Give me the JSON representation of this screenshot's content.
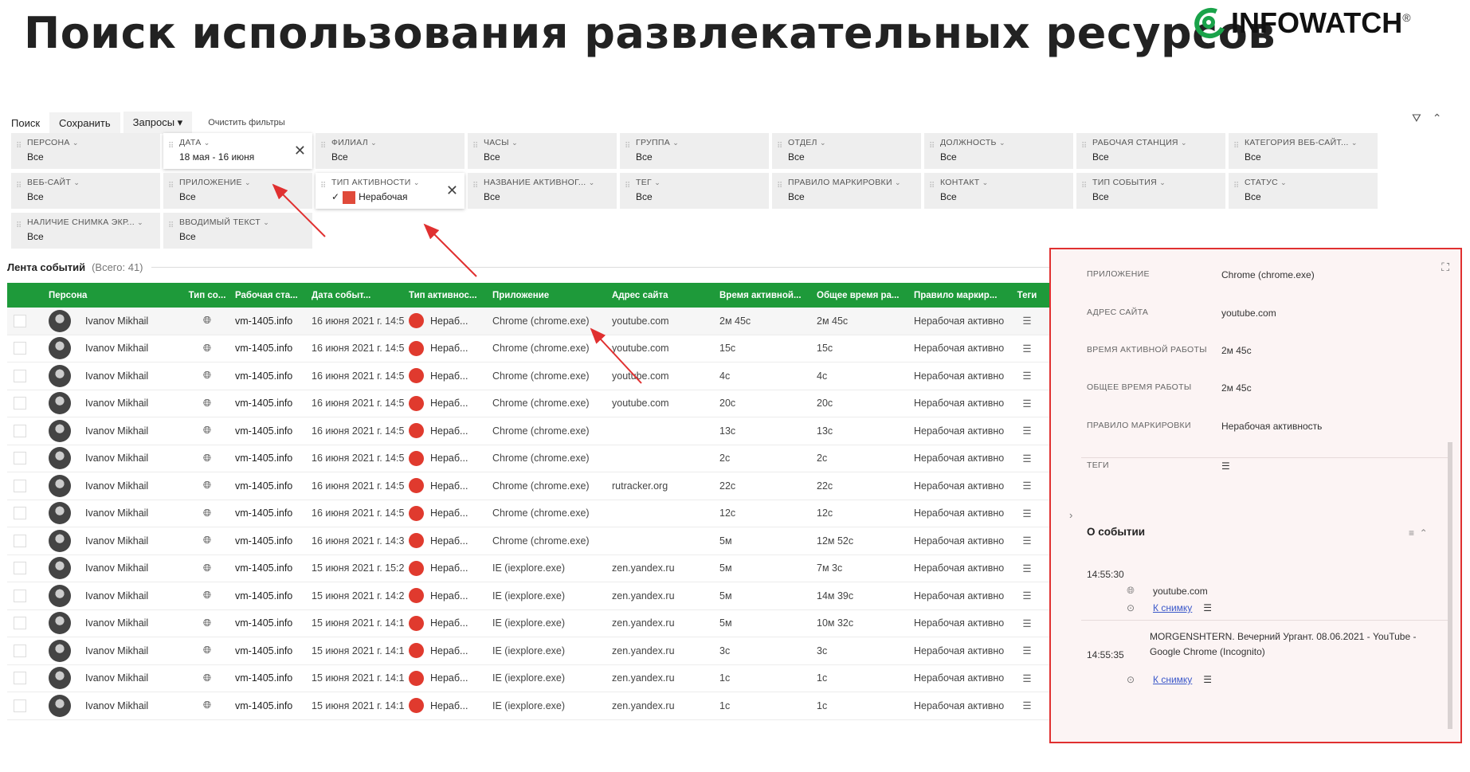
{
  "slide_title": "Поиск использования развлекательных ресурсов",
  "logo": {
    "text": "INFOWATCH",
    "reg": "®"
  },
  "toolbar": {
    "search": "Поиск",
    "save": "Сохранить",
    "queries": "Запросы ▾",
    "clear": "Очистить фильтры"
  },
  "top_icons": {
    "filter": "⛛",
    "collapse": "⌃"
  },
  "filters": {
    "row1": [
      {
        "label": "Персона",
        "value": "Все"
      },
      {
        "label": "Дата",
        "value": "18 мая - 16 июня",
        "active": true
      },
      {
        "label": "Филиал",
        "value": "Все"
      },
      {
        "label": "Часы",
        "value": "Все"
      },
      {
        "label": "Группа",
        "value": "Все"
      },
      {
        "label": "Отдел",
        "value": "Все"
      },
      {
        "label": "Должность",
        "value": "Все"
      },
      {
        "label": "Рабочая станция",
        "value": "Все"
      },
      {
        "label": "Категория веб-сайт...",
        "value": "Все"
      }
    ],
    "row2": [
      {
        "label": "Веб-сайт",
        "value": "Все"
      },
      {
        "label": "Приложение",
        "value": "Все"
      },
      {
        "label": "Тип активности",
        "value": "Нерабочая",
        "active": true
      },
      {
        "label": "Название активног...",
        "value": "Все"
      },
      {
        "label": "Тег",
        "value": "Все"
      },
      {
        "label": "Правило маркировки",
        "value": "Все"
      },
      {
        "label": "Контакт",
        "value": "Все"
      },
      {
        "label": "Тип события",
        "value": "Все"
      },
      {
        "label": "Статус",
        "value": "Все"
      }
    ],
    "row3": [
      {
        "label": "Наличие снимка экр...",
        "value": "Все"
      },
      {
        "label": "Вводимый текст",
        "value": "Все"
      }
    ]
  },
  "feed": {
    "title": "Лента событий",
    "count": "(Всего: 41)"
  },
  "table": {
    "columns": [
      "",
      "Персона",
      "Тип со...",
      "Рабочая ста...",
      "Дата событ...",
      "Тип активнос...",
      "Приложение",
      "Адрес сайта",
      "Время активной...",
      "Общее время ра...",
      "Правило маркир...",
      "Теги"
    ],
    "rows": [
      {
        "person": "Ivanov Mikhail",
        "ws": "vm-1405.info",
        "date": "16 июня 2021 г. 14:5",
        "act": "Нераб...",
        "app": "Chrome (chrome.exe)",
        "url": "youtube.com",
        "time": "2м 45с",
        "total": "2м 45с",
        "rule": "Нерабочая активно"
      },
      {
        "person": "Ivanov Mikhail",
        "ws": "vm-1405.info",
        "date": "16 июня 2021 г. 14:5",
        "act": "Нераб...",
        "app": "Chrome (chrome.exe)",
        "url": "youtube.com",
        "time": "15с",
        "total": "15с",
        "rule": "Нерабочая активно"
      },
      {
        "person": "Ivanov Mikhail",
        "ws": "vm-1405.info",
        "date": "16 июня 2021 г. 14:5",
        "act": "Нераб...",
        "app": "Chrome (chrome.exe)",
        "url": "youtube.com",
        "time": "4с",
        "total": "4с",
        "rule": "Нерабочая активно"
      },
      {
        "person": "Ivanov Mikhail",
        "ws": "vm-1405.info",
        "date": "16 июня 2021 г. 14:5",
        "act": "Нераб...",
        "app": "Chrome (chrome.exe)",
        "url": "youtube.com",
        "time": "20с",
        "total": "20с",
        "rule": "Нерабочая активно"
      },
      {
        "person": "Ivanov Mikhail",
        "ws": "vm-1405.info",
        "date": "16 июня 2021 г. 14:5",
        "act": "Нераб...",
        "app": "Chrome (chrome.exe)",
        "url": "",
        "time": "13с",
        "total": "13с",
        "rule": "Нерабочая активно"
      },
      {
        "person": "Ivanov Mikhail",
        "ws": "vm-1405.info",
        "date": "16 июня 2021 г. 14:5",
        "act": "Нераб...",
        "app": "Chrome (chrome.exe)",
        "url": "",
        "time": "2с",
        "total": "2с",
        "rule": "Нерабочая активно"
      },
      {
        "person": "Ivanov Mikhail",
        "ws": "vm-1405.info",
        "date": "16 июня 2021 г. 14:5",
        "act": "Нераб...",
        "app": "Chrome (chrome.exe)",
        "url": "rutracker.org",
        "time": "22с",
        "total": "22с",
        "rule": "Нерабочая активно"
      },
      {
        "person": "Ivanov Mikhail",
        "ws": "vm-1405.info",
        "date": "16 июня 2021 г. 14:5",
        "act": "Нераб...",
        "app": "Chrome (chrome.exe)",
        "url": "",
        "time": "12с",
        "total": "12с",
        "rule": "Нерабочая активно"
      },
      {
        "person": "Ivanov Mikhail",
        "ws": "vm-1405.info",
        "date": "16 июня 2021 г. 14:3",
        "act": "Нераб...",
        "app": "Chrome (chrome.exe)",
        "url": "",
        "time": "5м",
        "total": "12м 52с",
        "rule": "Нерабочая активно"
      },
      {
        "person": "Ivanov Mikhail",
        "ws": "vm-1405.info",
        "date": "15 июня 2021 г. 15:2",
        "act": "Нераб...",
        "app": "IE (iexplore.exe)",
        "url": "zen.yandex.ru",
        "time": "5м",
        "total": "7м 3с",
        "rule": "Нерабочая активно"
      },
      {
        "person": "Ivanov Mikhail",
        "ws": "vm-1405.info",
        "date": "15 июня 2021 г. 14:2",
        "act": "Нераб...",
        "app": "IE (iexplore.exe)",
        "url": "zen.yandex.ru",
        "time": "5м",
        "total": "14м 39с",
        "rule": "Нерабочая активно"
      },
      {
        "person": "Ivanov Mikhail",
        "ws": "vm-1405.info",
        "date": "15 июня 2021 г. 14:1",
        "act": "Нераб...",
        "app": "IE (iexplore.exe)",
        "url": "zen.yandex.ru",
        "time": "5м",
        "total": "10м 32с",
        "rule": "Нерабочая активно"
      },
      {
        "person": "Ivanov Mikhail",
        "ws": "vm-1405.info",
        "date": "15 июня 2021 г. 14:1",
        "act": "Нераб...",
        "app": "IE (iexplore.exe)",
        "url": "zen.yandex.ru",
        "time": "3с",
        "total": "3с",
        "rule": "Нерабочая активно"
      },
      {
        "person": "Ivanov Mikhail",
        "ws": "vm-1405.info",
        "date": "15 июня 2021 г. 14:1",
        "act": "Нераб...",
        "app": "IE (iexplore.exe)",
        "url": "zen.yandex.ru",
        "time": "1с",
        "total": "1с",
        "rule": "Нерабочая активно"
      },
      {
        "person": "Ivanov Mikhail",
        "ws": "vm-1405.info",
        "date": "15 июня 2021 г. 14:1",
        "act": "Нераб...",
        "app": "IE (iexplore.exe)",
        "url": "zen.yandex.ru",
        "time": "1с",
        "total": "1с",
        "rule": "Нерабочая активно"
      }
    ]
  },
  "detail": {
    "fields": [
      {
        "k": "Приложение",
        "v": "Chrome (chrome.exe)"
      },
      {
        "k": "Адрес сайта",
        "v": "youtube.com"
      },
      {
        "k": "Время активной работы",
        "v": "2м 45с"
      },
      {
        "k": "Общее время работы",
        "v": "2м 45с"
      },
      {
        "k": "Правило маркировки",
        "v": "Нерабочая активность"
      },
      {
        "k": "Теги",
        "v": ""
      }
    ],
    "section_title": "О событии",
    "events": [
      {
        "time": "14:55:30",
        "site": "youtube.com",
        "link": "К снимку"
      },
      {
        "time": "14:55:35",
        "title": "MORGENSHTERN. Вечерний Ургант. 08.06.2021 - YouTube - Google Chrome (Incognito)",
        "link": "К снимку"
      }
    ]
  },
  "colors": {
    "header_green": "#1e9a3a",
    "activity_red": "#e03a2e",
    "highlight_border": "#e03030"
  }
}
